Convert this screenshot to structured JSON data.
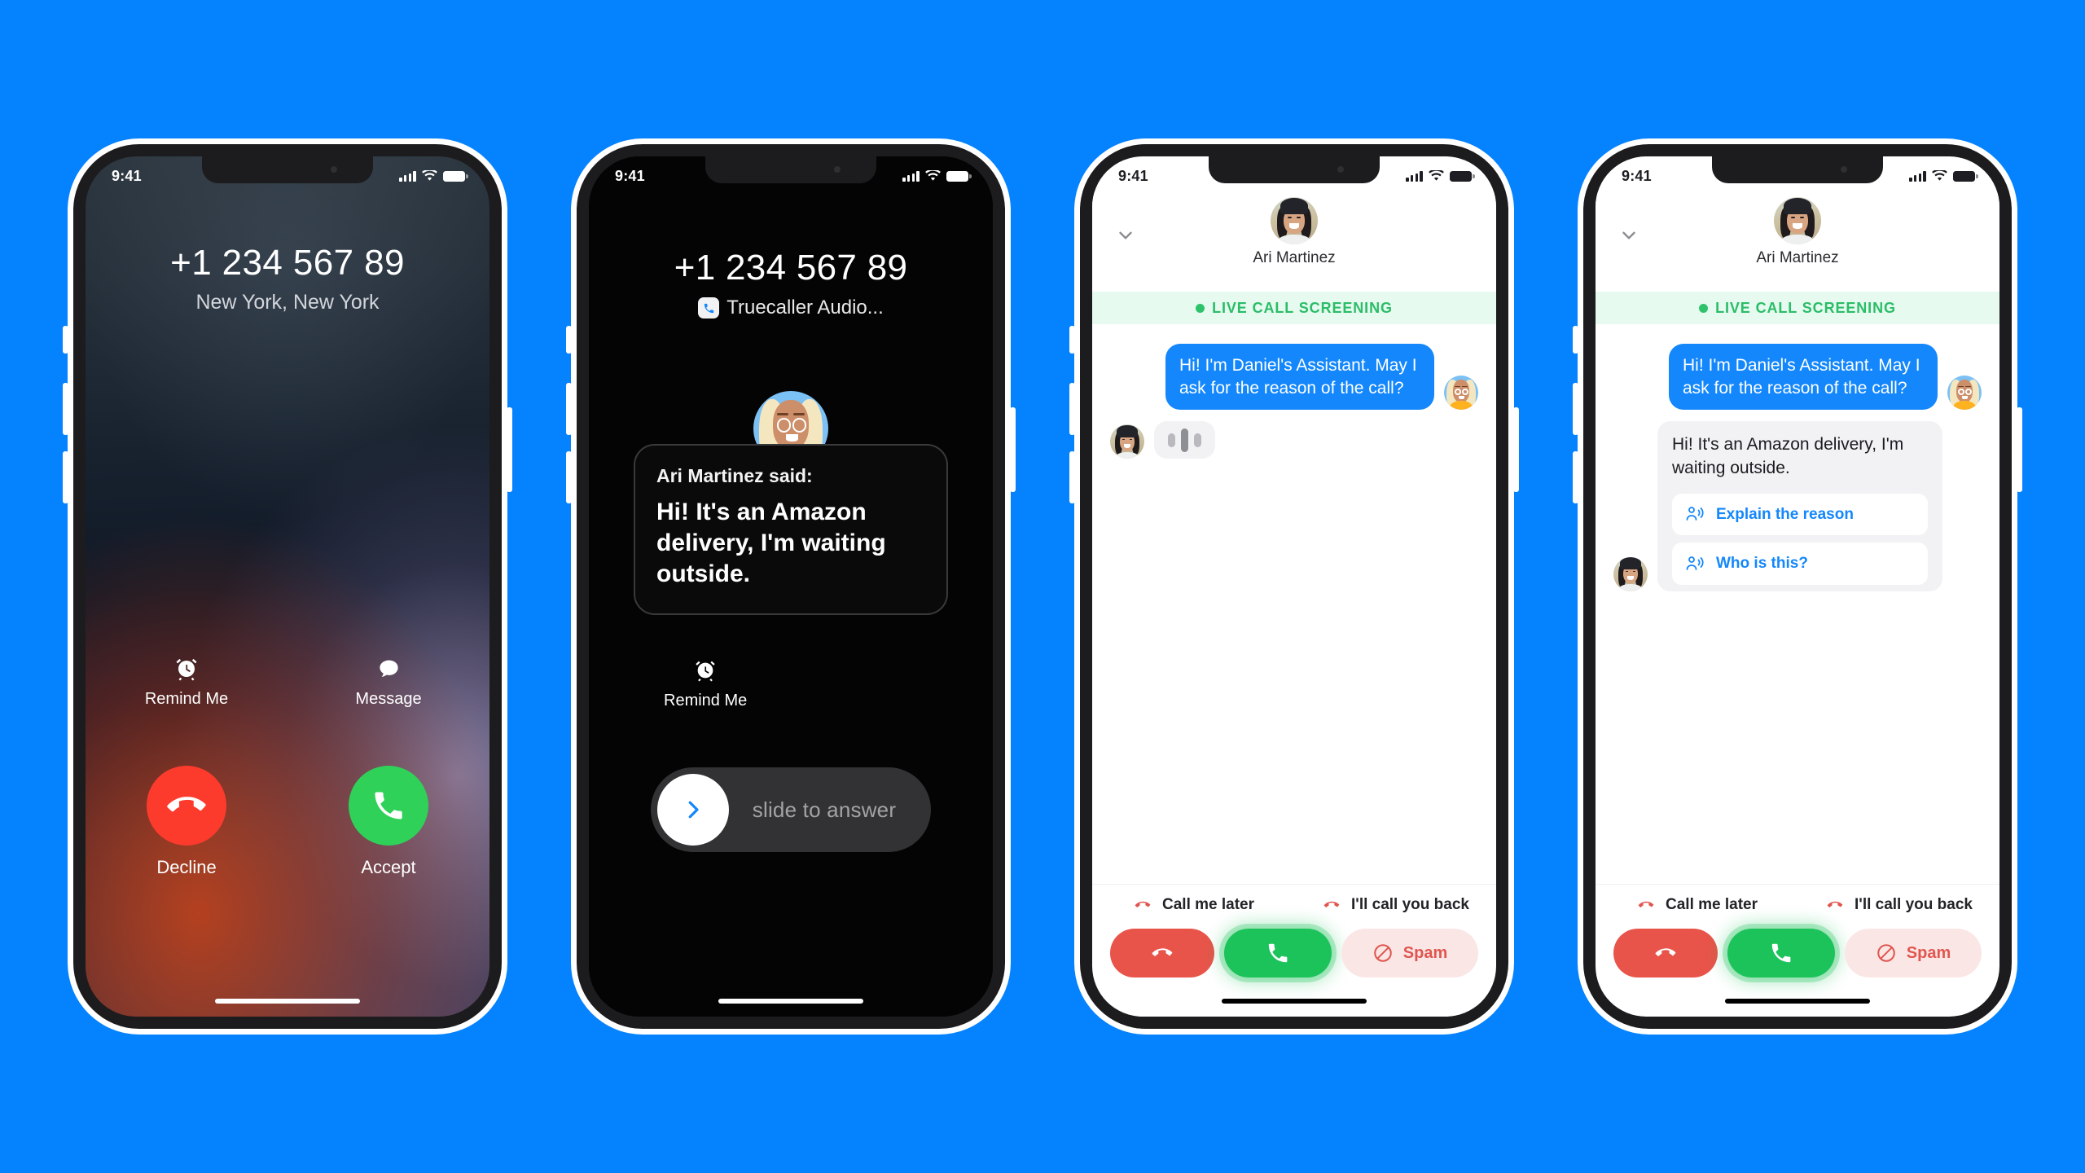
{
  "theme": {
    "background_blue": "#0582FE",
    "accent_blue": "#1387FB",
    "green": "#1BC35A",
    "red": "#E8544A",
    "screening_green": "#2BBD67"
  },
  "status_bar": {
    "time": "9:41",
    "signal_icon": "cellular-signal-icon",
    "wifi_icon": "wifi-icon",
    "battery_icon": "battery-icon"
  },
  "phone1": {
    "number": "+1 234 567 89",
    "location": "New York, New York",
    "soft_actions": [
      {
        "icon": "alarm-clock-icon",
        "label": "Remind Me"
      },
      {
        "icon": "message-bubble-icon",
        "label": "Message"
      }
    ],
    "call_actions": [
      {
        "icon": "hangup-phone-icon",
        "label": "Decline",
        "color": "#FC3B2D"
      },
      {
        "icon": "phone-icon",
        "label": "Accept",
        "color": "#2FD158"
      }
    ]
  },
  "phone2": {
    "number": "+1 234 567 89",
    "app_label": "Truecaller Audio...",
    "app_icon": "truecaller-phone-icon",
    "avatar": "assistant-illustration-avatar",
    "card": {
      "speaker": "Ari Martinez said:",
      "message": "Hi! It's an Amazon delivery, I'm waiting outside."
    },
    "remind": {
      "icon": "alarm-clock-icon",
      "label": "Remind Me"
    },
    "slider": {
      "label": "slide to answer",
      "knob_icon": "chevron-right-icon"
    }
  },
  "phone3": {
    "back_icon": "chevron-down-icon",
    "contact_name": "Ari Martinez",
    "contact_avatar": "ari-martinez-photo-avatar",
    "banner": {
      "label": "LIVE CALL SCREENING",
      "dot": "live-status-dot"
    },
    "messages": [
      {
        "side": "out",
        "text": "Hi! I'm Daniel's Assistant. May I ask for the reason of the call?",
        "avatar": "assistant-illustration-avatar"
      },
      {
        "side": "in",
        "type": "typing",
        "avatar": "ari-martinez-photo-avatar"
      }
    ],
    "quick_replies": [
      {
        "icon": "hangup-phone-icon",
        "label": "Call me later"
      },
      {
        "icon": "hangup-phone-icon",
        "label": "I'll call you back"
      }
    ],
    "call_bar": [
      {
        "name": "hangup-button",
        "icon": "hangup-phone-icon",
        "label": ""
      },
      {
        "name": "answer-button",
        "icon": "phone-icon",
        "label": ""
      },
      {
        "name": "spam-button",
        "icon": "block-circle-icon",
        "label": "Spam"
      }
    ]
  },
  "phone4": {
    "back_icon": "chevron-down-icon",
    "contact_name": "Ari Martinez",
    "contact_avatar": "ari-martinez-photo-avatar",
    "banner": {
      "label": "LIVE CALL SCREENING",
      "dot": "live-status-dot"
    },
    "messages": [
      {
        "side": "out",
        "text": "Hi! I'm Daniel's Assistant. May I ask for the reason of the call?",
        "avatar": "assistant-illustration-avatar"
      },
      {
        "side": "in",
        "text": "Hi! It's an Amazon delivery, I'm waiting outside.",
        "avatar": "ari-martinez-photo-avatar",
        "suggestions": [
          {
            "icon": "speaking-person-icon",
            "label": "Explain the reason"
          },
          {
            "icon": "speaking-person-icon",
            "label": "Who is this?"
          }
        ]
      }
    ],
    "quick_replies": [
      {
        "icon": "hangup-phone-icon",
        "label": "Call me later"
      },
      {
        "icon": "hangup-phone-icon",
        "label": "I'll call you back"
      }
    ],
    "call_bar": [
      {
        "name": "hangup-button",
        "icon": "hangup-phone-icon",
        "label": ""
      },
      {
        "name": "answer-button",
        "icon": "phone-icon",
        "label": ""
      },
      {
        "name": "spam-button",
        "icon": "block-circle-icon",
        "label": "Spam"
      }
    ]
  }
}
